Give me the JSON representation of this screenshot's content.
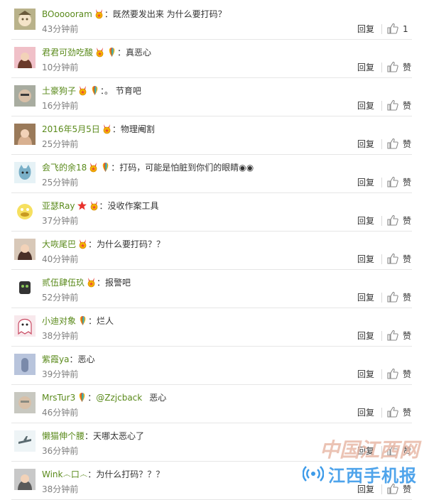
{
  "reply_label": "回复",
  "like_label": "赞",
  "comments": [
    {
      "user": "BOooooram",
      "badges": [
        "medal"
      ],
      "text": "既然要发出来  为什么要打码？",
      "time": "43分钟前",
      "likes": "1",
      "avatar": {
        "bg": "#b9b28a",
        "fg": "#6a5a3a",
        "shape": "cartoon"
      }
    },
    {
      "user": "君君可劲吃酸",
      "badges": [
        "medal",
        "rainbow"
      ],
      "text": "真恶心",
      "time": "10分钟前",
      "likes": "",
      "avatar": {
        "bg": "#f0c0c8",
        "fg": "#6a3a2a",
        "shape": "girl"
      }
    },
    {
      "user": "土豪狗子",
      "badges": [
        "medal",
        "rainbow"
      ],
      "text": "。  节育吧",
      "time": "16分钟前",
      "likes": "",
      "avatar": {
        "bg": "#a8aca0",
        "fg": "#3a3a3a",
        "shape": "face"
      }
    },
    {
      "user": "2016年5月5日",
      "badges": [
        "medal"
      ],
      "text": "物理阉割",
      "time": "25分钟前",
      "likes": "",
      "avatar": {
        "bg": "#9a7a5a",
        "fg": "#d8b090",
        "shape": "girl"
      }
    },
    {
      "user": "会飞的余18",
      "badges": [
        "medal",
        "rainbow"
      ],
      "text": "打码，可能是怕脏到你们的眼睛◉◉",
      "time": "25分钟前",
      "likes": "",
      "avatar": {
        "bg": "#e6f2f6",
        "fg": "#7ab0c8",
        "shape": "cat"
      }
    },
    {
      "user": "亚瑟Ray",
      "badges": [
        "star",
        "medal"
      ],
      "text": "没收作案工具",
      "time": "37分钟前",
      "likes": "",
      "avatar": {
        "bg": "#f6e060",
        "fg": "#c89a20",
        "shape": "duck"
      }
    },
    {
      "user": "大咴尾巴",
      "badges": [
        "medal"
      ],
      "text": "为什么要打码？？",
      "time": "40分钟前",
      "likes": "",
      "avatar": {
        "bg": "#d8c8b8",
        "fg": "#4a3028",
        "shape": "girl"
      }
    },
    {
      "user": "贰伍肆伍玖",
      "badges": [
        "medal"
      ],
      "text": "报警吧",
      "time": "52分钟前",
      "likes": "",
      "avatar": {
        "bg": "#ffffff",
        "fg": "#333333",
        "shape": "mask"
      }
    },
    {
      "user": "小迪对象",
      "badges": [
        "rainbow"
      ],
      "text": "烂人",
      "time": "38分钟前",
      "likes": "",
      "avatar": {
        "bg": "#f8e8ec",
        "fg": "#c84860",
        "shape": "ghost"
      }
    },
    {
      "user": "紫霞ya",
      "badges": [],
      "text": "恶心",
      "time": "39分钟前",
      "likes": "",
      "avatar": {
        "bg": "#b8c4dc",
        "fg": "#7a8aaa",
        "shape": "hand"
      }
    },
    {
      "user": "MrsTur3",
      "badges": [
        "rainbow"
      ],
      "text": "",
      "mention": "@Zzjcback",
      "mention_text": "恶心",
      "time": "46分钟前",
      "likes": "",
      "avatar": {
        "bg": "#c8c8c0",
        "fg": "#8a8a80",
        "shape": "face"
      }
    },
    {
      "user": "懒猫伸个腰",
      "badges": [],
      "text": "天哪太恶心了",
      "time": "36分钟前",
      "likes": "",
      "avatar": {
        "bg": "#eef4f6",
        "fg": "#5a6a70",
        "shape": "plane"
      }
    },
    {
      "user": "Wink෴口෴",
      "badges": [],
      "text": "为什么打码？？？",
      "time": "38分钟前",
      "likes": "",
      "avatar": {
        "bg": "#c8c8c8",
        "fg": "#5a5a5a",
        "shape": "girl"
      }
    }
  ],
  "watermark": {
    "top": "中国江西网",
    "bottom": "江西手机报"
  }
}
